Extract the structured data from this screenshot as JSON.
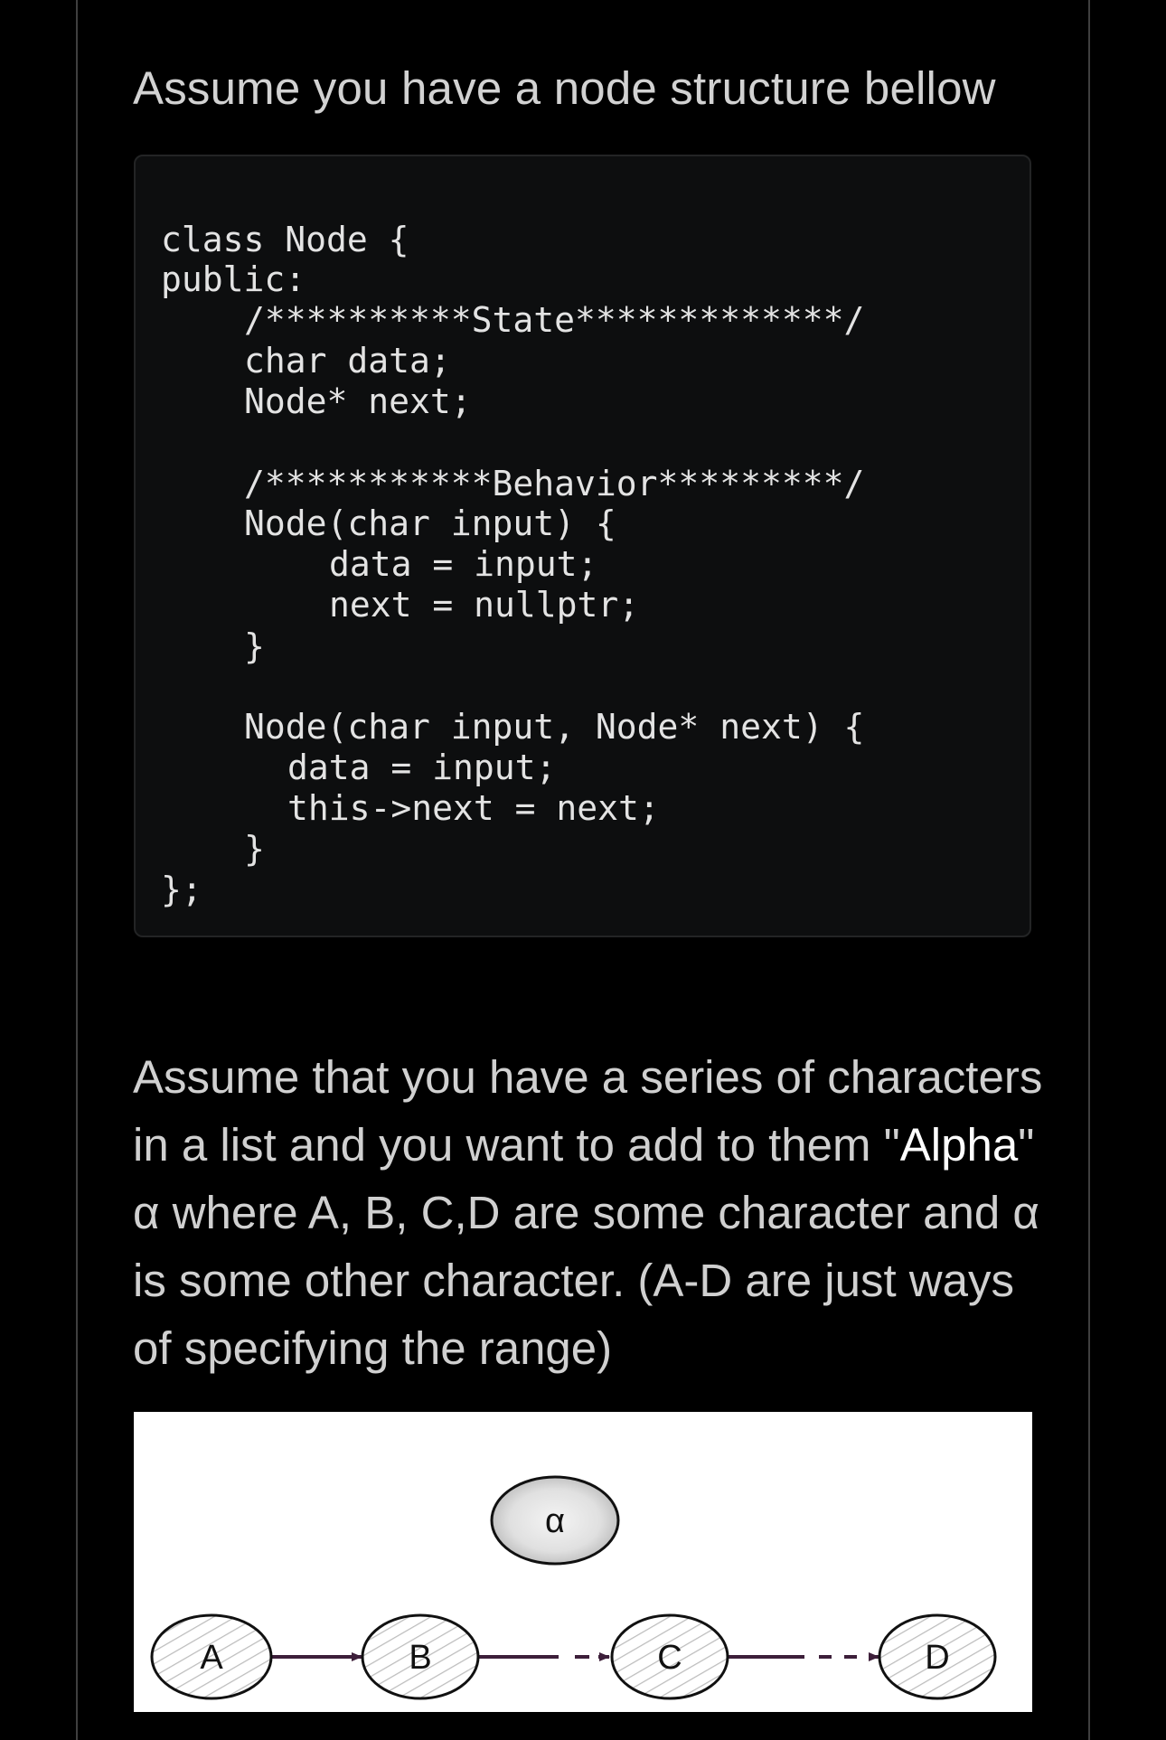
{
  "heading": "Assume you have a node structure bellow",
  "code": {
    "lines": [
      "class Node {",
      "public:",
      "/**********State*************/",
      "char data;",
      "Node* next;",
      "/***********Behavior*********/",
      "Node(char input) {",
      "data = input;",
      "next = nullptr;",
      "}",
      "Node(char input, Node* next) {",
      "data = input;",
      "this->next = next;",
      "}",
      "};"
    ]
  },
  "paragraph": {
    "line1": "Assume that you have a series of characters",
    "line2_pre": "in a list and you want to add to them \"",
    "line2_alpha": "Alpha",
    "line2_post": "\"",
    "line3": "α where A, B, C,D are some character and α",
    "line4": "is some other character. (A-D are just ways",
    "line5": "of specifying the range)"
  },
  "diagram": {
    "nodes": {
      "a": "A",
      "b": "B",
      "c": "C",
      "d": "D",
      "alpha": "α"
    },
    "arrow_color": "#3d1f3a"
  }
}
